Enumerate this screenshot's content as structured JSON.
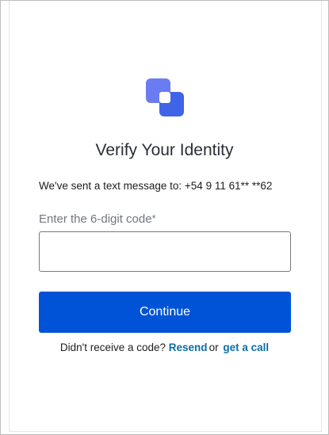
{
  "page": {
    "title": "Verify Your Identity",
    "message": "We've sent a text message to: +54 9 11 61** **62"
  },
  "code_field": {
    "label": "Enter the 6-digit code",
    "required_mark": "*",
    "value": "",
    "placeholder": ""
  },
  "continue_button": {
    "label": "Continue"
  },
  "resend": {
    "prompt": "Didn't receive a code?",
    "resend_label": "Resend",
    "or_text": "or",
    "call_label": "get a call"
  },
  "colors": {
    "primary": "#0053d6",
    "link": "#0a6ea8",
    "logo_back": "#6b7cf2",
    "logo_front": "#3f64e8"
  }
}
